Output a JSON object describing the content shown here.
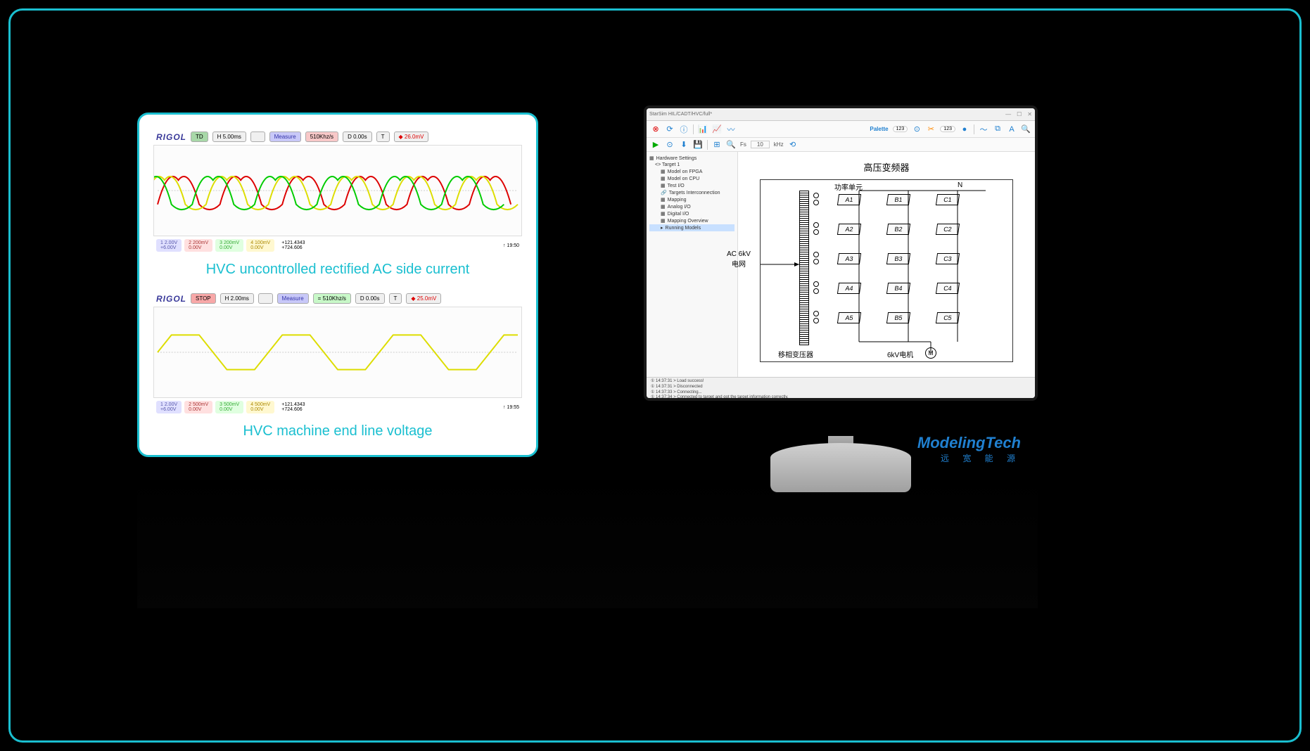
{
  "oscilloscope": {
    "brand": "RIGOL",
    "scope1": {
      "mode": "TD",
      "hdiv": "H  5.00ms",
      "measure": "Measure",
      "khz": "510Khz/s",
      "d": "D  0.00s",
      "t": "T",
      "trig": "◆ 26.0mV",
      "ch1": "1  2.00V\n+6.00V",
      "ch2": "2  200mV\n0.00V",
      "ch3": "3  200mV\n0.00V",
      "ch4": "4  100mV\n0.00V",
      "stats": "+121.4343\n+724.606",
      "time": "↑ 19:50",
      "caption": "HVC uncontrolled rectified AC side current"
    },
    "scope2": {
      "mode": "STOP",
      "hdiv": "H  2.00ms",
      "measure": "Measure",
      "khz": "= 510Khz/s",
      "d": "D  0.00s",
      "t": "T",
      "trig": "◆ 25.0mV",
      "ch1": "1  2.00V\n+6.00V",
      "ch2": "2  500mV\n0.00V",
      "ch3": "3  500mV\n0.00V",
      "ch4": "4  500mV\n0.00V",
      "stats": "+121.4343\n+724.606",
      "time": "↑ 19:55",
      "caption": "HVC machine end line voltage"
    }
  },
  "monitor": {
    "brand": "ModelingTech",
    "brand_sub": "远 宽 能 源"
  },
  "app": {
    "title": "StarSim HIL/CADT/HVC/full*",
    "toolbar": {
      "palette": "Palette",
      "count1": "123",
      "count2": "123",
      "fs_label": "Fs",
      "fs_val": "10",
      "fs_unit": "kHz"
    },
    "tree": {
      "root": "Hardware Settings",
      "target": "<> Target 1",
      "items": [
        "Model on FPGA",
        "Model on CPU",
        "Test I/O",
        "Targets Interconnection",
        "Mapping",
        "Analog I/O",
        "Digital I/O",
        "Mapping Overview",
        "Running Models"
      ]
    },
    "diagram": {
      "title": "高压变频器",
      "ac_label": "AC 6kV\n电网",
      "xfmr_label": "移相变压器",
      "motor_label": "6kV电机",
      "pwr_unit": "功率单元",
      "neutral": "N",
      "motor": "M",
      "cells": [
        [
          "A1",
          "B1",
          "C1"
        ],
        [
          "A2",
          "B2",
          "C2"
        ],
        [
          "A3",
          "B3",
          "C3"
        ],
        [
          "A4",
          "B4",
          "C4"
        ],
        [
          "A5",
          "B5",
          "C5"
        ]
      ]
    },
    "console": [
      "① 14:37:31 > Load success!",
      "① 14:37:31 > Disconnected",
      "① 14:37:33 > Connecting...",
      "① 14:37:34 > Connected to target and got the target information correctly."
    ]
  }
}
